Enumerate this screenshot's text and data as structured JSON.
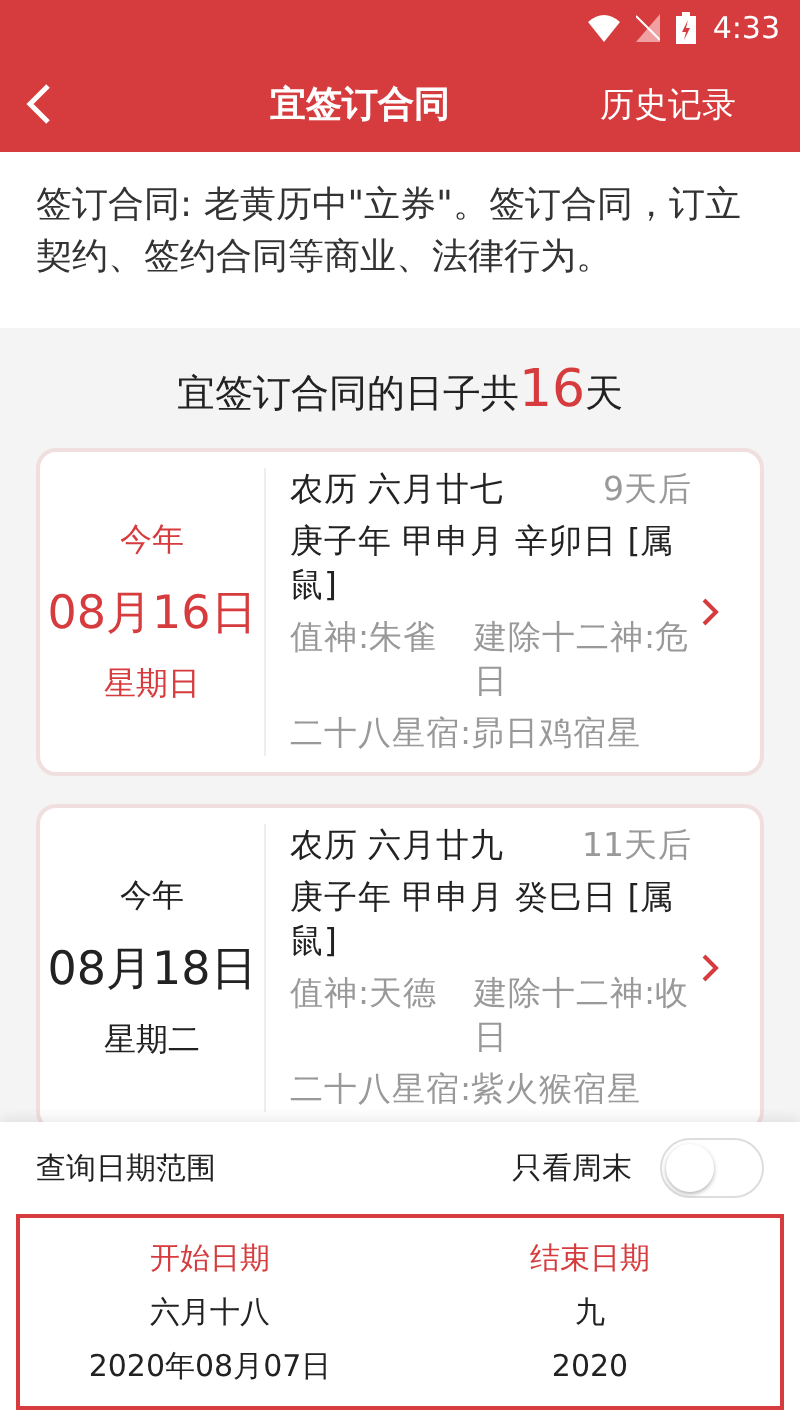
{
  "status_bar": {
    "time": "4:33"
  },
  "header": {
    "title": "宜签订合同",
    "action": "历史记录"
  },
  "description": "签订合同: 老黄历中\"立券\"。签订合同，订立契约、签约合同等商业、法律行为。",
  "summary": {
    "prefix": "宜签订合同的日子共",
    "count": "16",
    "suffix": "天"
  },
  "days": [
    {
      "year": "今年",
      "date": "08月16日",
      "weekday": "星期日",
      "highlight": true,
      "lunar": "农历 六月廿七",
      "until": "9天后",
      "ganzhi": "庚子年 甲申月 辛卯日 [属鼠]",
      "god": "值神:朱雀",
      "twelve": "建除十二神:危日",
      "star": "二十八星宿:昴日鸡宿星"
    },
    {
      "year": "今年",
      "date": "08月18日",
      "weekday": "星期二",
      "highlight": false,
      "lunar": "农历 六月廿九",
      "until": "11天后",
      "ganzhi": "庚子年 甲申月 癸巳日 [属鼠]",
      "god": "值神:天德",
      "twelve": "建除十二神:收日",
      "star": "二十八星宿:紫火猴宿星"
    }
  ],
  "range": {
    "label": "查询日期范围",
    "weekend_label": "只看周末",
    "weekend_only": false,
    "start": {
      "label": "开始日期",
      "lunar": "六月十八",
      "date": "2020年08月07日"
    },
    "end": {
      "label": "结束日期",
      "lunar": "九",
      "date": "2020"
    }
  }
}
